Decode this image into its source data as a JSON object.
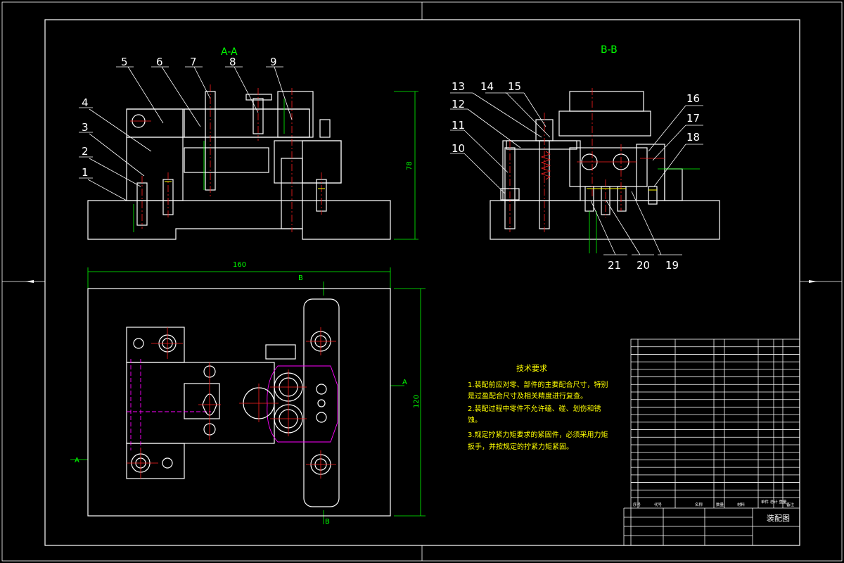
{
  "sheet": {
    "colors": {
      "background": "#000000",
      "outline": "#ffffff",
      "hatch": "#00ff00",
      "centerline": "#ff2020",
      "hidden": "#ff00ff",
      "thread": "#ffff00",
      "dimension": "#00ff00"
    }
  },
  "views": {
    "section_a": "A-A",
    "section_b": "B-B"
  },
  "balloons_a": [
    "1",
    "2",
    "3",
    "4",
    "5",
    "6",
    "7",
    "8",
    "9"
  ],
  "balloons_b": [
    "10",
    "11",
    "12",
    "13",
    "14",
    "15",
    "16",
    "17",
    "18",
    "19",
    "20",
    "21"
  ],
  "dimensions": {
    "height": "78",
    "width": "160",
    "depth": "120"
  },
  "section_marks": {
    "top_b": "B",
    "bottom_b": "B",
    "right_a": "A",
    "left_a": "A"
  },
  "technical_requirements": {
    "title": "技术要求",
    "lines": [
      "1.装配前应对零、部件的主要配合尺寸，特别",
      "是过盈配合尺寸及相关精度进行复查。",
      "2.装配过程中零件不允许磕、碰、划伤和锈",
      "蚀。",
      "3.规定拧紧力矩要求的紧固件，必须采用力矩",
      "扳手，并按规定的拧紧力矩紧固。"
    ]
  },
  "title_block": {
    "drawing_title": "装配图",
    "header_labels": [
      "序号",
      "代号",
      "名称",
      "数量",
      "材料",
      "单件 总计 重量",
      "备注"
    ],
    "bom_row_count": 21
  }
}
